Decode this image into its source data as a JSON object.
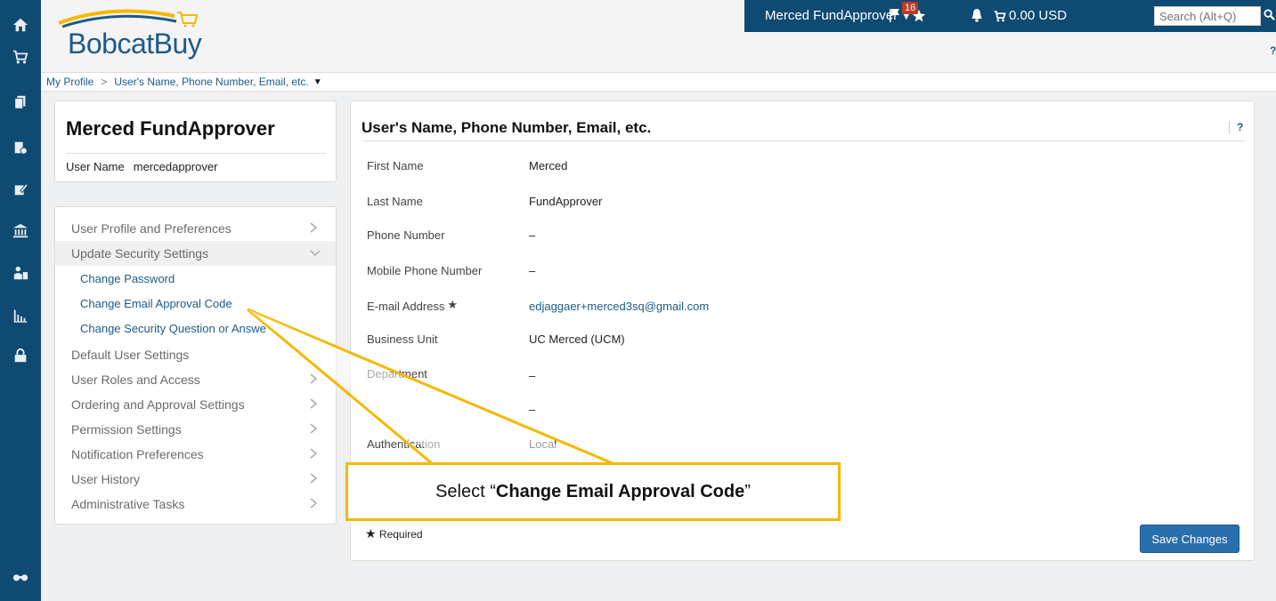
{
  "rail": {
    "icons": [
      "home-icon",
      "cart-icon",
      "documents-icon",
      "orders-icon",
      "edit-icon",
      "bank-icon",
      "suppliers-icon",
      "reports-icon",
      "admin-icon",
      "binoculars-icon"
    ]
  },
  "header": {
    "logo_text": "BobcatBuy",
    "user_menu": "Merced FundApprover",
    "flag_count": "16",
    "cart_amount": "0.00 USD",
    "search_placeholder": "Search (Alt+Q)",
    "help": "?"
  },
  "breadcrumb": {
    "items": [
      "My Profile",
      "User's Name, Phone Number, Email, etc."
    ]
  },
  "profile": {
    "name": "Merced FundApprover",
    "username_label": "User Name",
    "username_value": "mercedapprover"
  },
  "nav": {
    "items": [
      "User Profile and Preferences",
      "Update Security Settings",
      "Default User Settings",
      "User Roles and Access",
      "Ordering and Approval Settings",
      "Permission Settings",
      "Notification Preferences",
      "User History",
      "Administrative Tasks"
    ],
    "sub_items": [
      "Change Password",
      "Change Email Approval Code",
      "Change Security Question or Answe"
    ]
  },
  "main": {
    "title": "User's Name, Phone Number, Email, etc.",
    "help": "?",
    "fields": [
      {
        "label": "First Name",
        "value": "Merced"
      },
      {
        "label": "Last Name",
        "value": "FundApprover"
      },
      {
        "label": "Phone Number",
        "value": "–"
      },
      {
        "label": "Mobile Phone Number",
        "value": "–"
      },
      {
        "label": "E-mail Address",
        "value": "edjaggaer+merced3sq@gmail.com"
      },
      {
        "label": "Business Unit",
        "value": "UC Merced (UCM)"
      },
      {
        "label": "Department",
        "value": "–"
      },
      {
        "label": "",
        "value": "–"
      },
      {
        "label": "Authentication",
        "value": "Local"
      }
    ],
    "required_note": "Required",
    "save_label": "Save Changes"
  },
  "callout": {
    "prefix": "Select “",
    "bold": "Change Email Approval Code",
    "suffix": "”",
    "color": "#f5b800"
  },
  "colors": {
    "brand": "#0f4a72",
    "link": "#1d5a8a",
    "primary_button": "#2a6fad"
  }
}
